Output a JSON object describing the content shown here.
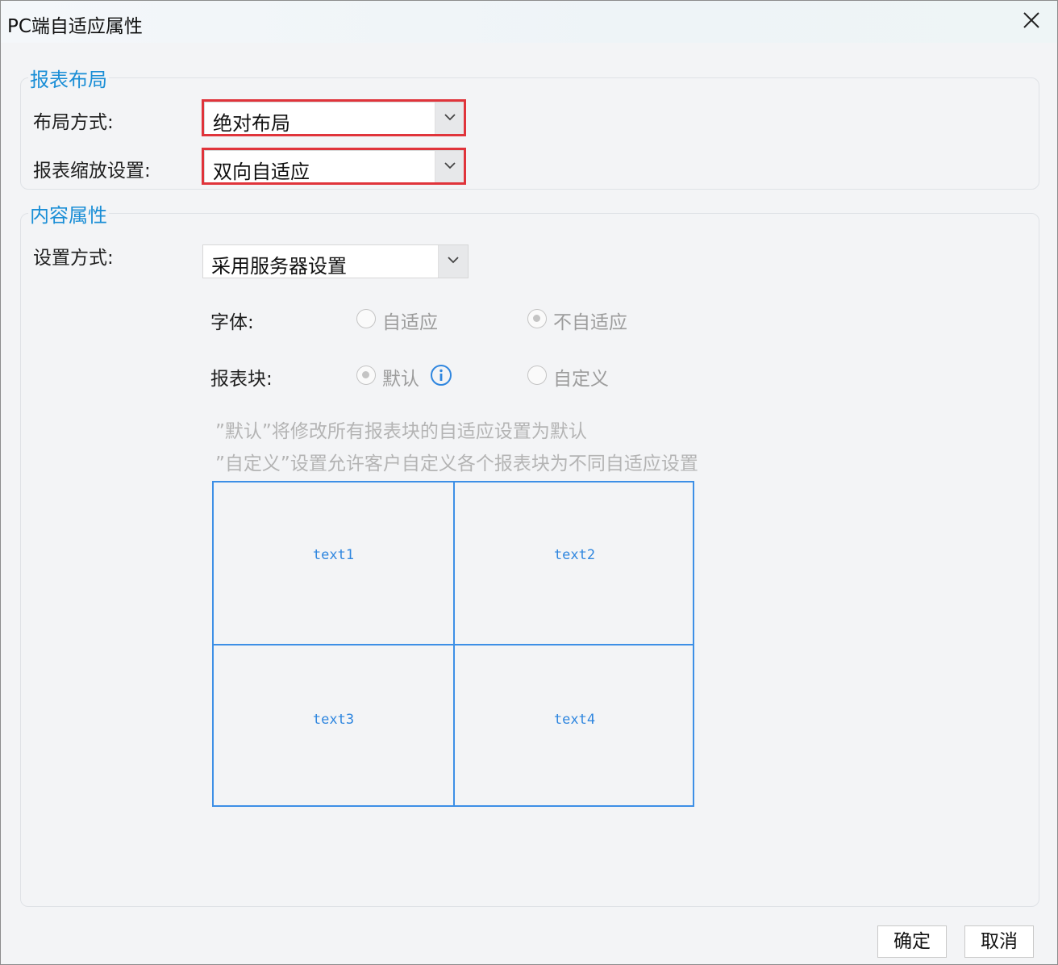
{
  "window": {
    "title": "PC端自适应属性"
  },
  "layout_group": {
    "title": "报表布局",
    "layout_mode": {
      "label": "布局方式:",
      "value": "绝对布局"
    },
    "scale_setting": {
      "label": "报表缩放设置:",
      "value": "双向自适应"
    }
  },
  "content_group": {
    "title": "内容属性",
    "setting_mode": {
      "label": "设置方式:",
      "value": "采用服务器设置"
    },
    "font": {
      "label": "字体:",
      "options": [
        {
          "label": "自适应",
          "checked": false
        },
        {
          "label": "不自适应",
          "checked": true
        }
      ]
    },
    "report_block": {
      "label": "报表块:",
      "options": [
        {
          "label": "默认",
          "checked": true
        },
        {
          "label": "自定义",
          "checked": false
        }
      ]
    },
    "hints": [
      "”默认”将修改所有报表块的自适应设置为默认",
      "”自定义”设置允许客户自定义各个报表块为不同自适应设置"
    ],
    "preview_cells": [
      "text1",
      "text2",
      "text3",
      "text4"
    ]
  },
  "buttons": {
    "ok": "确定",
    "cancel": "取消"
  },
  "colors": {
    "accent": "#1a8ed6",
    "highlight": "#e0343b",
    "preview_border": "#3d8fe6"
  },
  "icons": [
    "close-icon",
    "chevron-down-icon",
    "info-icon"
  ]
}
